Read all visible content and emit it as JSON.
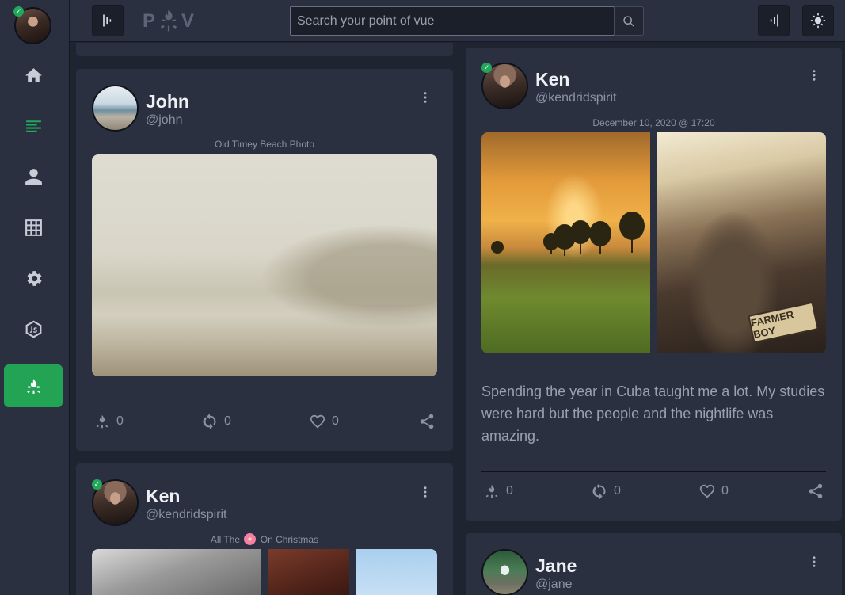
{
  "app": {
    "logo_text_left": "P",
    "logo_text_right": "V"
  },
  "search": {
    "placeholder": "Search your point of vue"
  },
  "sidebar": {
    "items": [
      {
        "name": "home",
        "icon": "home-icon"
      },
      {
        "name": "feed",
        "icon": "feed-icon"
      },
      {
        "name": "profile",
        "icon": "user-icon"
      },
      {
        "name": "grid",
        "icon": "grid-icon"
      },
      {
        "name": "settings",
        "icon": "gear-icon"
      },
      {
        "name": "node",
        "icon": "nodejs-icon"
      },
      {
        "name": "campfire",
        "icon": "campfire-icon"
      }
    ]
  },
  "colors": {
    "accent": "#23a455",
    "background": "#1f2431",
    "card": "#2a3040"
  },
  "posts": {
    "john": {
      "name": "John",
      "handle": "@john",
      "caption": "Old Timey Beach Photo",
      "stats": {
        "fires": "0",
        "reposts": "0",
        "likes": "0"
      }
    },
    "ken_feature": {
      "name": "Ken",
      "handle": "@kendridspirit",
      "caption": "December 10, 2020 @ 17:20",
      "text": "Spending the year in Cuba taught me a lot. My studies were hard but the people and the nightlife was amazing.",
      "plate_text": "FARMER BOY",
      "stats": {
        "fires": "0",
        "reposts": "0",
        "likes": "0"
      }
    },
    "ken_christmas": {
      "name": "Ken",
      "handle": "@kendridspirit",
      "caption_before": "All The",
      "caption_after": "On Christmas"
    },
    "jane": {
      "name": "Jane",
      "handle": "@jane"
    }
  }
}
